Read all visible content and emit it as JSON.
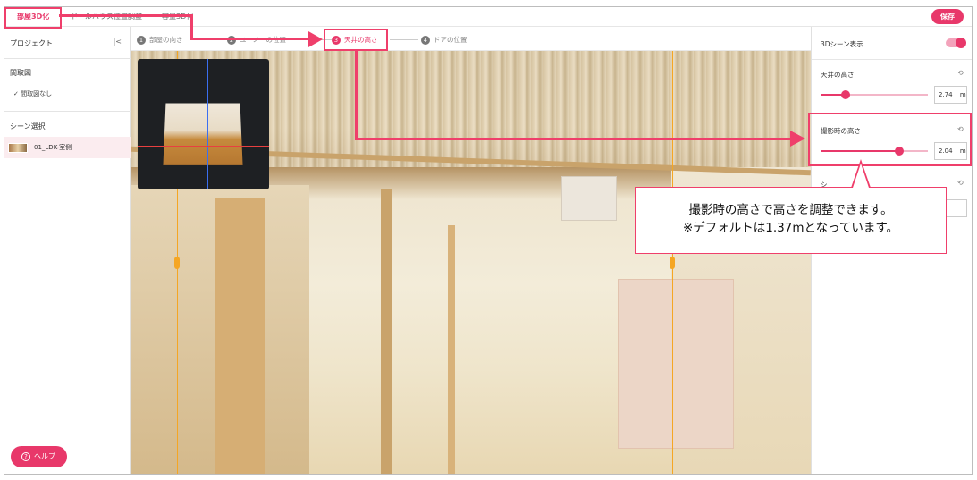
{
  "topbar": {
    "tabs": [
      {
        "label": "部屋3D化"
      },
      {
        "label": "ドールハウス位置調整"
      },
      {
        "label": "容量3D化"
      }
    ],
    "save_label": "保存"
  },
  "sidebar": {
    "title": "プロジェクト",
    "collapse_icon": "|<",
    "floorplan_section": "間取図",
    "floorplan_item": "✓ 間取図なし",
    "scene_section": "シーン選択",
    "scene_item": "01_LDK-室側",
    "help_label": "ヘルプ",
    "help_icon": "?"
  },
  "steps": [
    {
      "num": "1",
      "label": "部屋の向き"
    },
    {
      "num": "2",
      "label": "ユーノーの位置"
    },
    {
      "num": "3",
      "label": "天井の高さ"
    },
    {
      "num": "4",
      "label": "ドアの位置"
    }
  ],
  "rpanel": {
    "scene_display_label": "3Dシーン表示",
    "scene_display_on": true,
    "ceiling_height": {
      "label": "天井の高さ",
      "value": "2.74",
      "unit": "m",
      "fraction": 0.23
    },
    "camera_height": {
      "label": "撮影時の高さ",
      "value": "2.04",
      "unit": "m",
      "fraction": 0.73
    },
    "third_label": "シ"
  },
  "callout": {
    "line1": "撮影時の高さで高さを調整できます。",
    "line2": "※デフォルトは1.37mとなっています。"
  },
  "colors": {
    "accent": "#e8386a",
    "annotation": "#ef3f6b",
    "guide": "#f5a623"
  }
}
